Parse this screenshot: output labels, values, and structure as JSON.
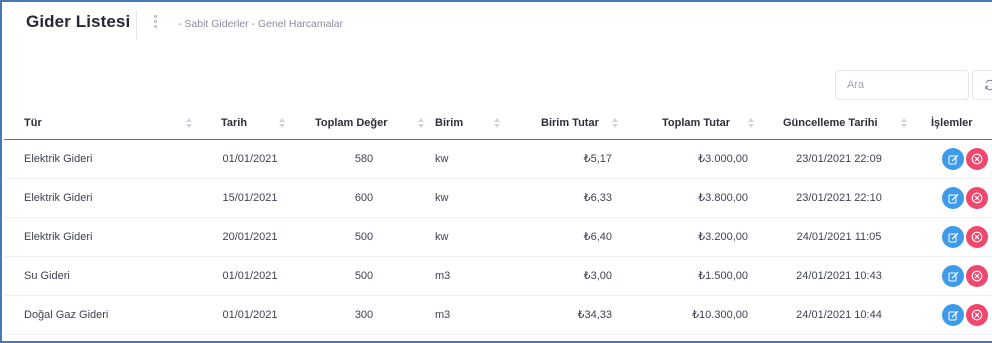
{
  "header": {
    "title": "Gider Listesi",
    "breadcrumb": "- Sabit Giderler - Genel Harcamalar"
  },
  "search": {
    "placeholder": "Ara"
  },
  "table": {
    "columns": [
      "Tür",
      "Tarih",
      "Toplam Değer",
      "Birim",
      "Birim Tutar",
      "Toplam Tutar",
      "Güncelleme Tarihi",
      "İşlemler"
    ],
    "rows": [
      {
        "tur": "Elektrik Gideri",
        "tarih": "01/01/2021",
        "toplam_deger": "580",
        "birim": "kw",
        "birim_tutar": "₺5,17",
        "toplam_tutar": "₺3.000,00",
        "guncelleme": "23/01/2021 22:09"
      },
      {
        "tur": "Elektrik Gideri",
        "tarih": "15/01/2021",
        "toplam_deger": "600",
        "birim": "kw",
        "birim_tutar": "₺6,33",
        "toplam_tutar": "₺3.800,00",
        "guncelleme": "23/01/2021 22:10"
      },
      {
        "tur": "Elektrik Gideri",
        "tarih": "20/01/2021",
        "toplam_deger": "500",
        "birim": "kw",
        "birim_tutar": "₺6,40",
        "toplam_tutar": "₺3.200,00",
        "guncelleme": "24/01/2021 11:05"
      },
      {
        "tur": "Su Gideri",
        "tarih": "01/01/2021",
        "toplam_deger": "500",
        "birim": "m3",
        "birim_tutar": "₺3,00",
        "toplam_tutar": "₺1.500,00",
        "guncelleme": "24/01/2021 10:43"
      },
      {
        "tur": "Doğal Gaz Gideri",
        "tarih": "01/01/2021",
        "toplam_deger": "300",
        "birim": "m3",
        "birim_tutar": "₺34,33",
        "toplam_tutar": "₺10.300,00",
        "guncelleme": "24/01/2021 10:44"
      }
    ]
  },
  "icons": {
    "edit": "edit-icon",
    "delete": "delete-icon",
    "refresh": "refresh-icon",
    "sort": "sort-icon"
  },
  "colors": {
    "accent": "#4a78b5",
    "edit": "#3e9bea",
    "delete": "#f0476c"
  }
}
